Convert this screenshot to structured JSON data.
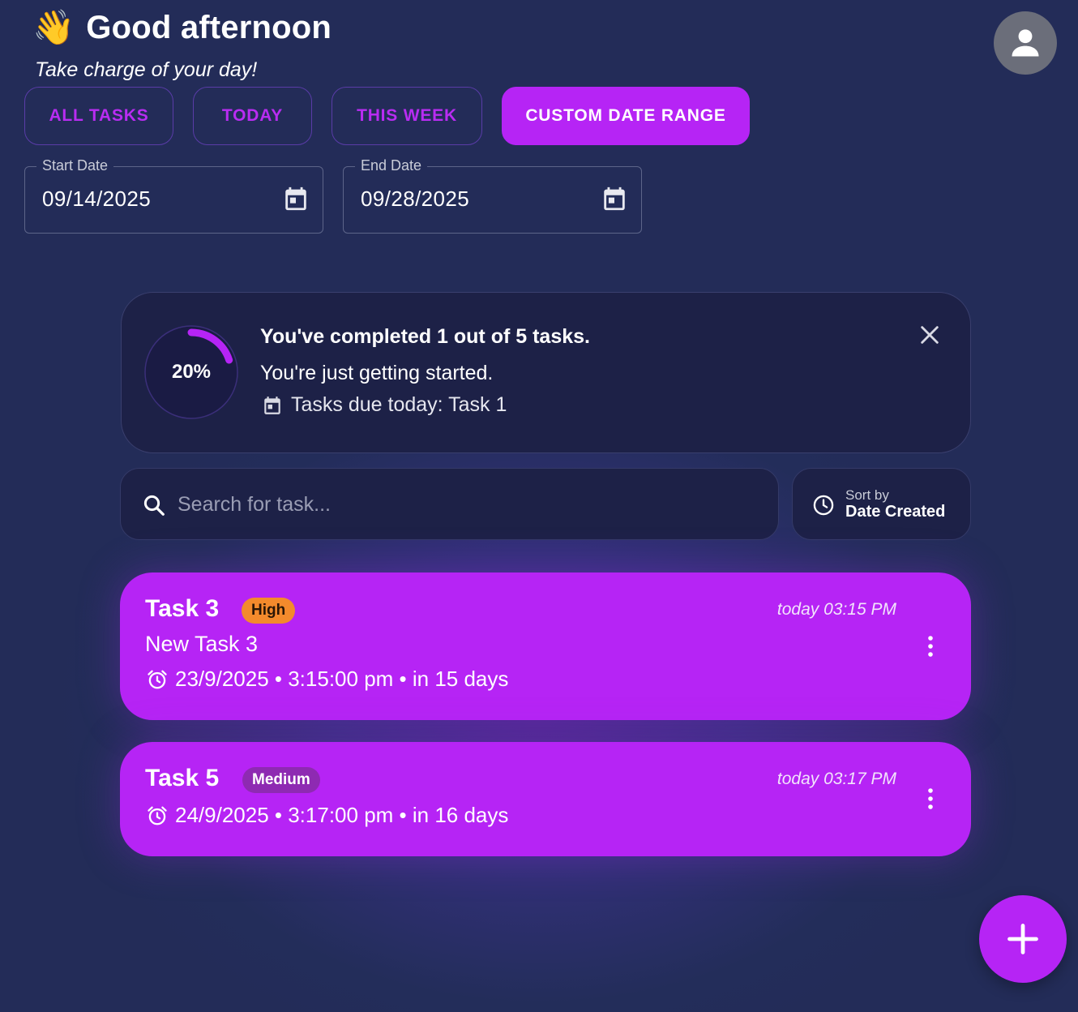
{
  "header": {
    "wave_emoji": "👋",
    "greeting": "Good afternoon",
    "tagline": "Take charge of your day!",
    "avatar_icon": "person-icon"
  },
  "filters": [
    {
      "label": "ALL TASKS",
      "active": false
    },
    {
      "label": "TODAY",
      "active": false
    },
    {
      "label": "THIS WEEK",
      "active": false
    },
    {
      "label": "CUSTOM DATE RANGE",
      "active": true
    }
  ],
  "date_range": {
    "start": {
      "label": "Start Date",
      "value": "09/14/2025"
    },
    "end": {
      "label": "End Date",
      "value": "09/28/2025"
    }
  },
  "progress": {
    "percent_label": "20%",
    "fraction": 0.2,
    "title": "You've completed 1 out of 5 tasks.",
    "subtitle": "You're just getting started.",
    "due_today": "Tasks due today: Task 1"
  },
  "search": {
    "placeholder": "Search for task..."
  },
  "sort": {
    "caption": "Sort by",
    "value": "Date Created"
  },
  "tasks": [
    {
      "name": "Task 3",
      "priority": "High",
      "created": "today 03:15 PM",
      "description": "New Task 3",
      "due": "23/9/2025 • 3:15:00 pm • in 15 days"
    },
    {
      "name": "Task 5",
      "priority": "Medium",
      "created": "today 03:17 PM",
      "description": "",
      "due": "24/9/2025 • 3:17:00 pm • in 16 days"
    }
  ],
  "colors": {
    "accent": "#b624f5",
    "background": "#232c58",
    "card": "#1d2147",
    "high_priority": "#f38a2c",
    "medium_priority": "#8e2ab2"
  }
}
